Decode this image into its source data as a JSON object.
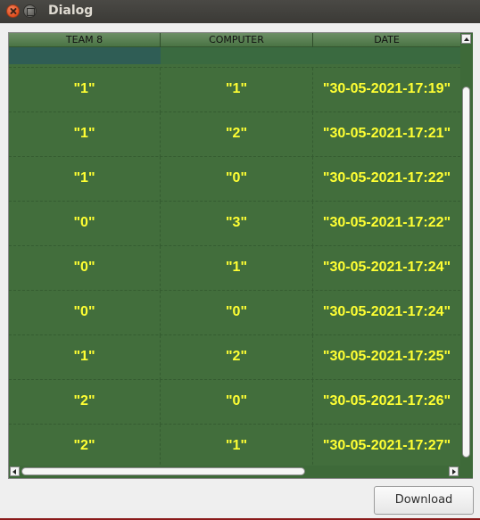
{
  "window": {
    "title": "Dialog",
    "close_icon": "close-icon",
    "minimize_icon": "minimize-icon"
  },
  "table": {
    "columns": [
      "TEAM 8",
      "COMPUTER",
      "DATE"
    ],
    "rows": [
      [
        "\"1\"",
        "\"1\"",
        "\"30-05-2021-17:19\""
      ],
      [
        "\"1\"",
        "\"2\"",
        "\"30-05-2021-17:21\""
      ],
      [
        "\"1\"",
        "\"0\"",
        "\"30-05-2021-17:22\""
      ],
      [
        "\"0\"",
        "\"3\"",
        "\"30-05-2021-17:22\""
      ],
      [
        "\"0\"",
        "\"1\"",
        "\"30-05-2021-17:24\""
      ],
      [
        "\"0\"",
        "\"0\"",
        "\"30-05-2021-17:24\""
      ],
      [
        "\"1\"",
        "\"2\"",
        "\"30-05-2021-17:25\""
      ],
      [
        "\"2\"",
        "\"0\"",
        "\"30-05-2021-17:26\""
      ],
      [
        "\"2\"",
        "\"1\"",
        "\"30-05-2021-17:27\""
      ]
    ],
    "colors": {
      "background": "#426e3c",
      "text": "#ffff33",
      "selected_cell": "#2f5d55"
    }
  },
  "actions": {
    "download_label": "Download"
  }
}
